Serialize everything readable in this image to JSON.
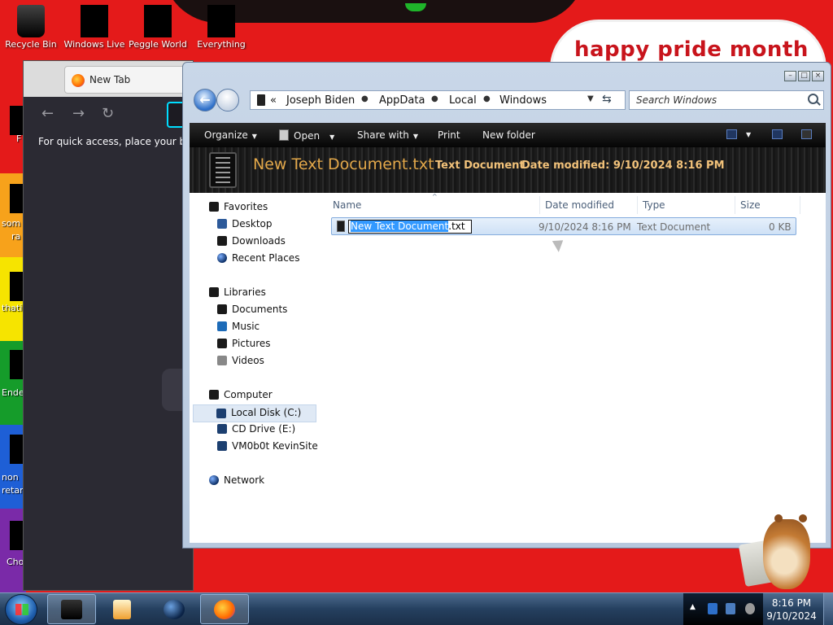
{
  "desktop": {
    "pride_text": "happy pride month",
    "icons": [
      {
        "label": "Recycle Bin"
      },
      {
        "label": "Windows Live"
      },
      {
        "label": "Peggle World"
      },
      {
        "label": "Everything"
      }
    ],
    "side_labels": [
      "F",
      "som",
      "ra",
      "thati",
      "Ende",
      "non",
      "retar",
      "Cho"
    ]
  },
  "browser": {
    "tab_label": "New Tab",
    "bookmarks_text": "For quick access, place your book"
  },
  "explorer": {
    "breadcrumb": [
      "Joseph Biden",
      "AppData",
      "Local",
      "Windows"
    ],
    "breadcrumb_overflow": "«",
    "search_placeholder": "Search Windows",
    "toolbar": {
      "organize": "Organize",
      "open": "Open",
      "share_with": "Share with",
      "print": "Print",
      "new_folder": "New folder"
    },
    "details": {
      "name": "New Text Document.txt",
      "type": "Text Document",
      "date_modified": "Date modified: 9/10/2024 8:16 PM"
    },
    "nav": {
      "favorites": "Favorites",
      "desktop": "Desktop",
      "downloads": "Downloads",
      "recent_places": "Recent Places",
      "libraries": "Libraries",
      "documents": "Documents",
      "music": "Music",
      "pictures": "Pictures",
      "videos": "Videos",
      "computer": "Computer",
      "local_disk": "Local Disk (C:)",
      "cd_drive": "CD Drive (E:)",
      "vm_site": "VM0b0t KevinSite",
      "network": "Network"
    },
    "columns": {
      "name": "Name",
      "date_modified": "Date modified",
      "type": "Type",
      "size": "Size"
    },
    "files": [
      {
        "name_selected": "New Text Document",
        "name_ext": ".txt",
        "date": "9/10/2024 8:16 PM",
        "type": "Text Document",
        "size": "0 KB"
      }
    ]
  },
  "taskbar": {
    "time": "8:16 PM",
    "date": "9/10/2024"
  }
}
